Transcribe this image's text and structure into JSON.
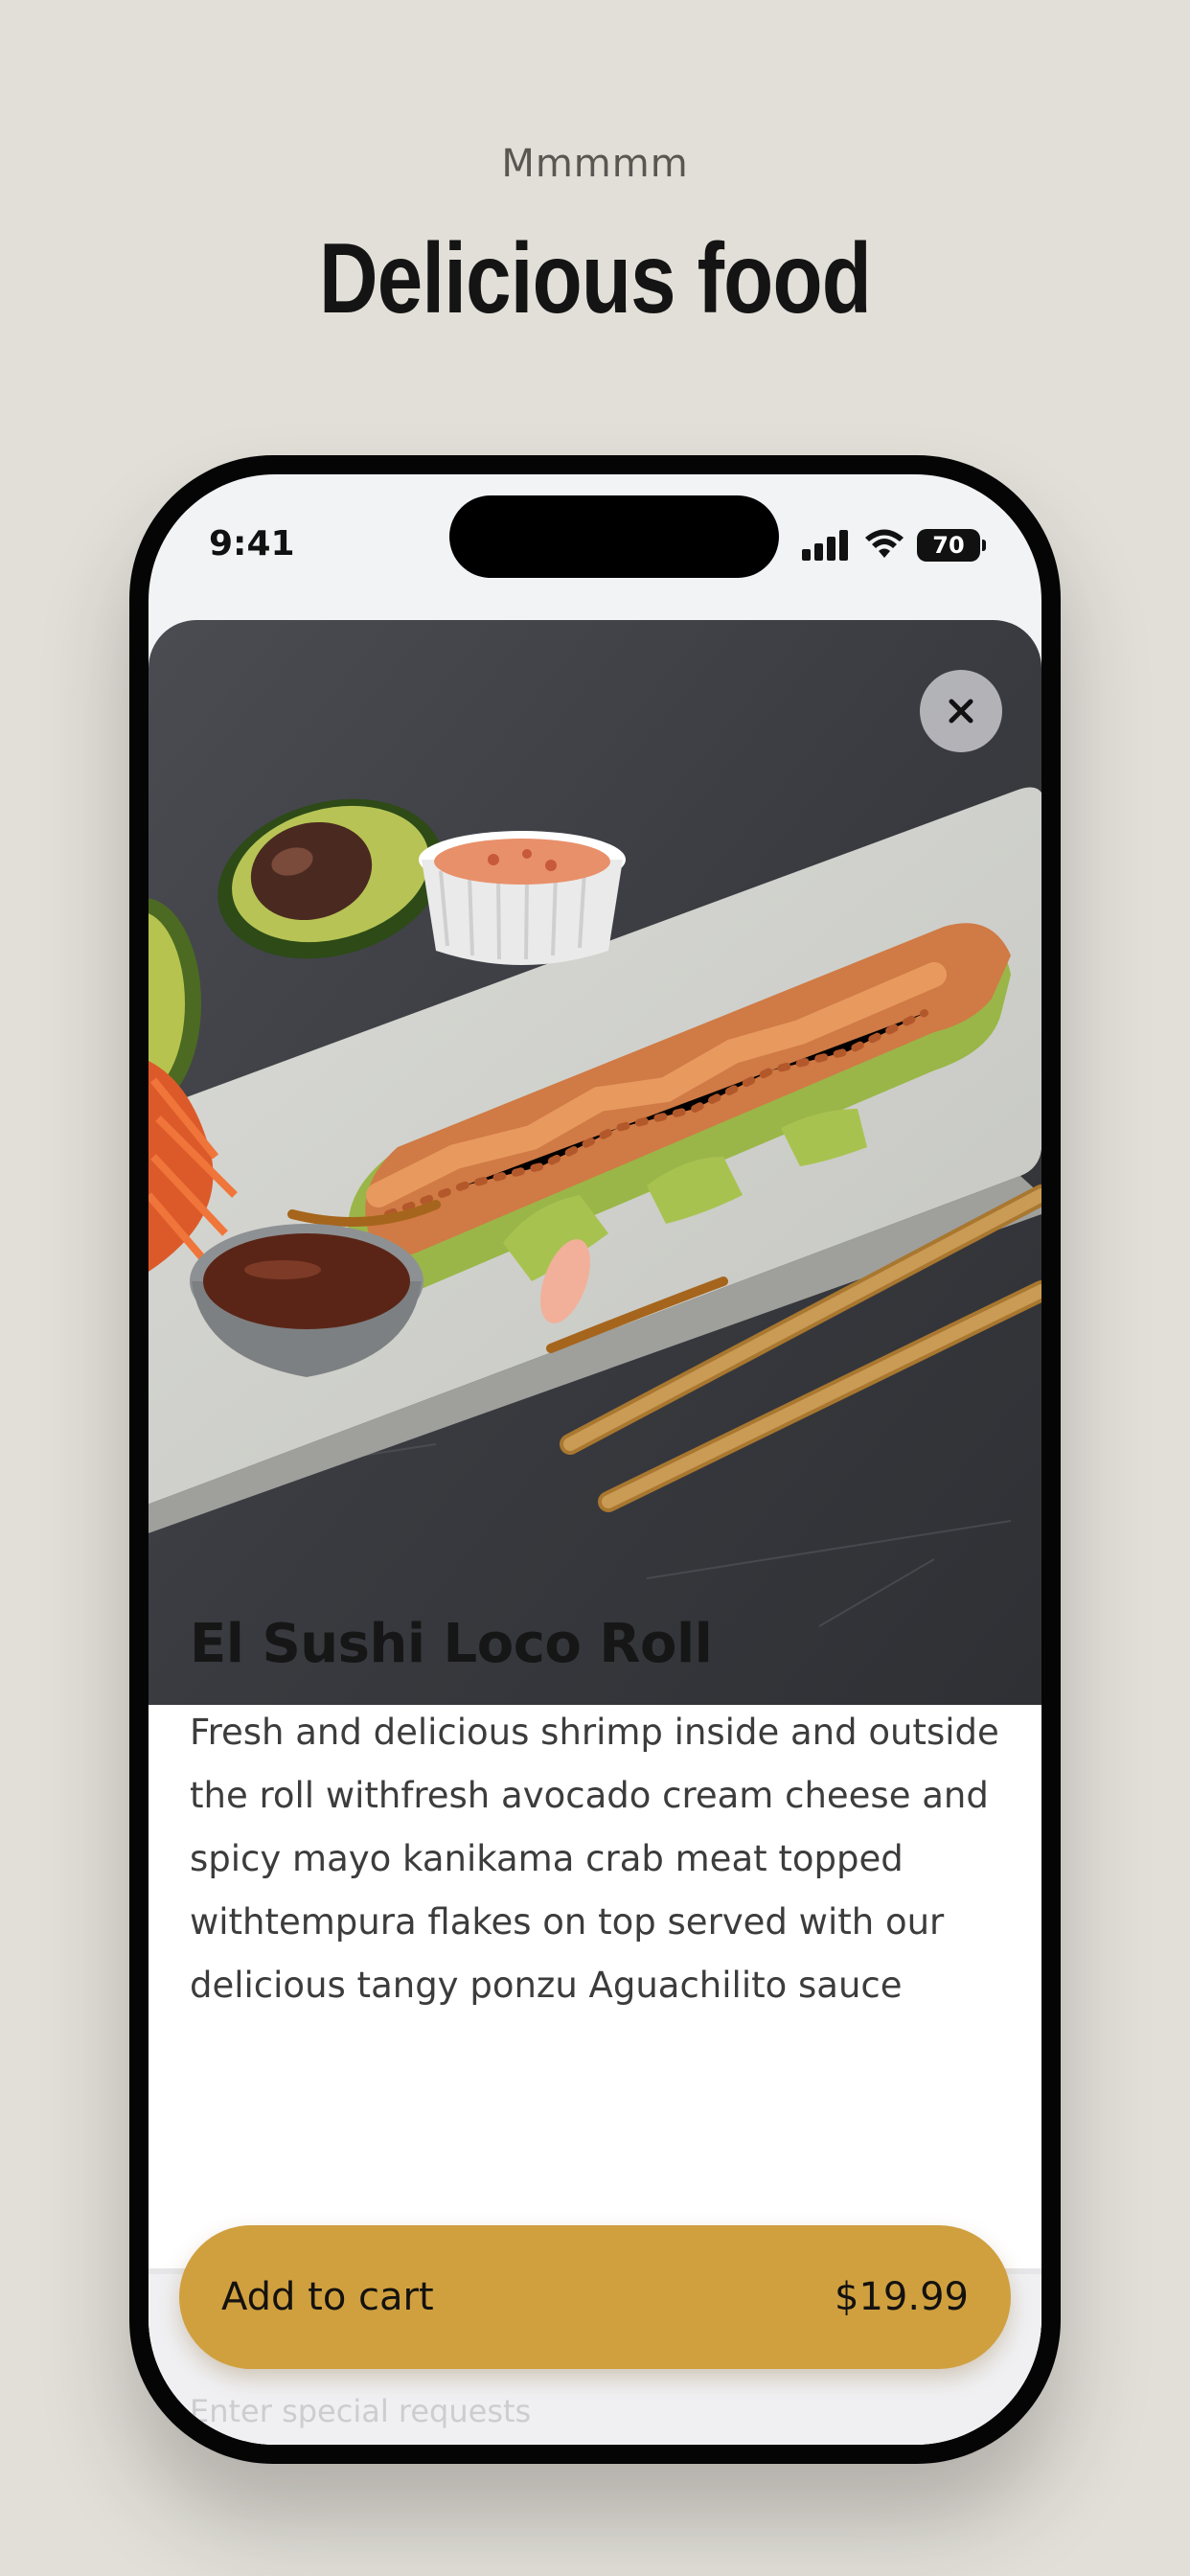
{
  "promo": {
    "eyebrow": "Mmmmm",
    "headline": "Delicious food"
  },
  "status_bar": {
    "time": "9:41",
    "battery": "70",
    "icons": [
      "signal-icon",
      "wifi-icon",
      "battery-icon"
    ]
  },
  "item": {
    "title": "El Sushi Loco Roll",
    "description": "Fresh and delicious shrimp inside and outside the roll withfresh avocado cream cheese and spicy mayo kanikama crab meat topped withtempura flakes on top served with our delicious tangy ponzu Aguachilito sauce",
    "image_alt": "El Sushi Loco Roll on a white plate with avocado, ponzu sauce and chopsticks"
  },
  "special_requests": {
    "placeholder": "Enter special requests"
  },
  "cart": {
    "label": "Add to cart",
    "price": "$19.99"
  },
  "colors": {
    "page_background": "#e2dfd9",
    "accent": "#d0a03f",
    "heading": "#141414"
  }
}
